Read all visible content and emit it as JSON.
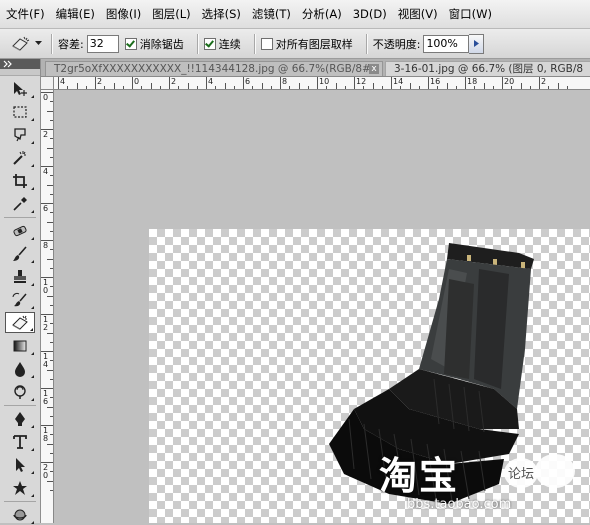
{
  "menus": [
    "文件(F)",
    "编辑(E)",
    "图像(I)",
    "图层(L)",
    "选择(S)",
    "滤镜(T)",
    "分析(A)",
    "3D(D)",
    "视图(V)",
    "窗口(W)"
  ],
  "options": {
    "tolerance_label": "容差:",
    "tolerance_value": "32",
    "anti_alias_label": "消除锯齿",
    "anti_alias_checked": true,
    "contiguous_label": "连续",
    "contiguous_checked": true,
    "sample_all_layers_label": "对所有图层取样",
    "sample_all_layers_checked": false,
    "opacity_label": "不透明度:",
    "opacity_value": "100%"
  },
  "tabs": [
    {
      "title": "T2gr5oXfXXXXXXXXXXX_!!114344128.jpg @ 66.7%(RGB/8#)",
      "active": true,
      "close": "x"
    },
    {
      "title": "3-16-01.jpg @ 66.7% (图层 0, RGB/8",
      "active": false
    }
  ],
  "ruler_h_labels": [
    "4",
    "2",
    "0",
    "2",
    "4",
    "6",
    "8",
    "10",
    "12",
    "14",
    "16",
    "18",
    "20",
    "2"
  ],
  "ruler_v_labels": [
    "0",
    "2",
    "4",
    "6",
    "8",
    "1\n0",
    "1\n2",
    "1\n4",
    "1\n6",
    "1\n8",
    "2\n0"
  ],
  "watermark": {
    "main": "淘宝",
    "suffix": "论坛",
    "url": "bbs.taobao.com"
  },
  "tools": [
    "move-tool-icon",
    "marquee-tool-icon",
    "lasso-tool-icon",
    "quick-selection-tool-icon",
    "crop-tool-icon",
    "eyedropper-tool-icon",
    "healing-brush-tool-icon",
    "brush-tool-icon",
    "clone-stamp-tool-icon",
    "history-brush-tool-icon",
    "eraser-tool-icon",
    "gradient-tool-icon",
    "blur-tool-icon",
    "dodge-tool-icon",
    "pen-tool-icon",
    "type-tool-icon",
    "path-selection-tool-icon",
    "custom-shape-tool-icon",
    "3d-rotate-tool-icon"
  ],
  "colors": {
    "canvas_bg": "#c0c0c0",
    "toolbox_bg": "#d8d8d8",
    "accent": "#3c6fd6"
  }
}
